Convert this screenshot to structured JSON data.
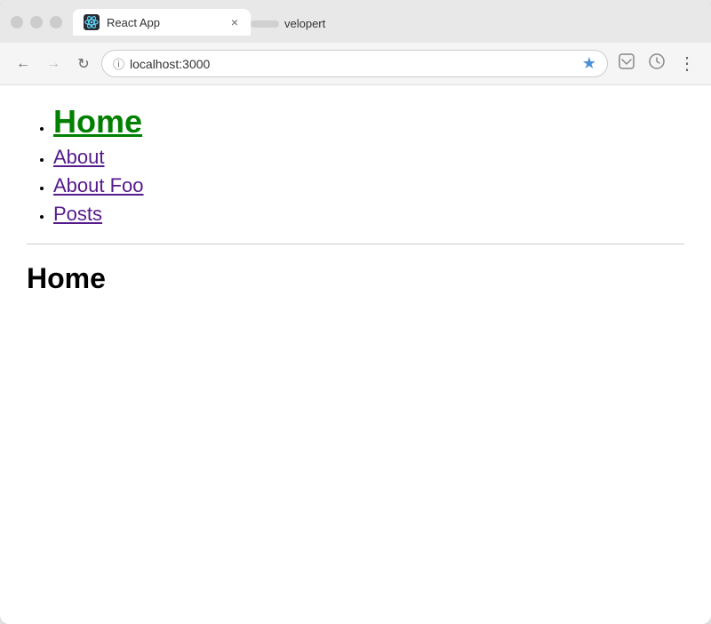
{
  "browser": {
    "window_controls": [
      "close",
      "minimize",
      "maximize"
    ],
    "tab": {
      "favicon_alt": "React logo",
      "title": "React App",
      "close_label": "×"
    },
    "profile_button_label": "",
    "profile_name": "velopert",
    "nav": {
      "back_label": "←",
      "forward_label": "→",
      "reload_label": "↻",
      "address": "localhost:3000",
      "star_label": "★",
      "pocket_label": "⊡",
      "history_label": "⊙",
      "menu_label": "⋮"
    }
  },
  "page": {
    "nav_links": [
      {
        "id": "home",
        "label": "Home",
        "active": true
      },
      {
        "id": "about",
        "label": "About",
        "active": false
      },
      {
        "id": "about-foo",
        "label": "About Foo",
        "active": false
      },
      {
        "id": "posts",
        "label": "Posts",
        "active": false
      }
    ],
    "content_heading": "Home"
  }
}
